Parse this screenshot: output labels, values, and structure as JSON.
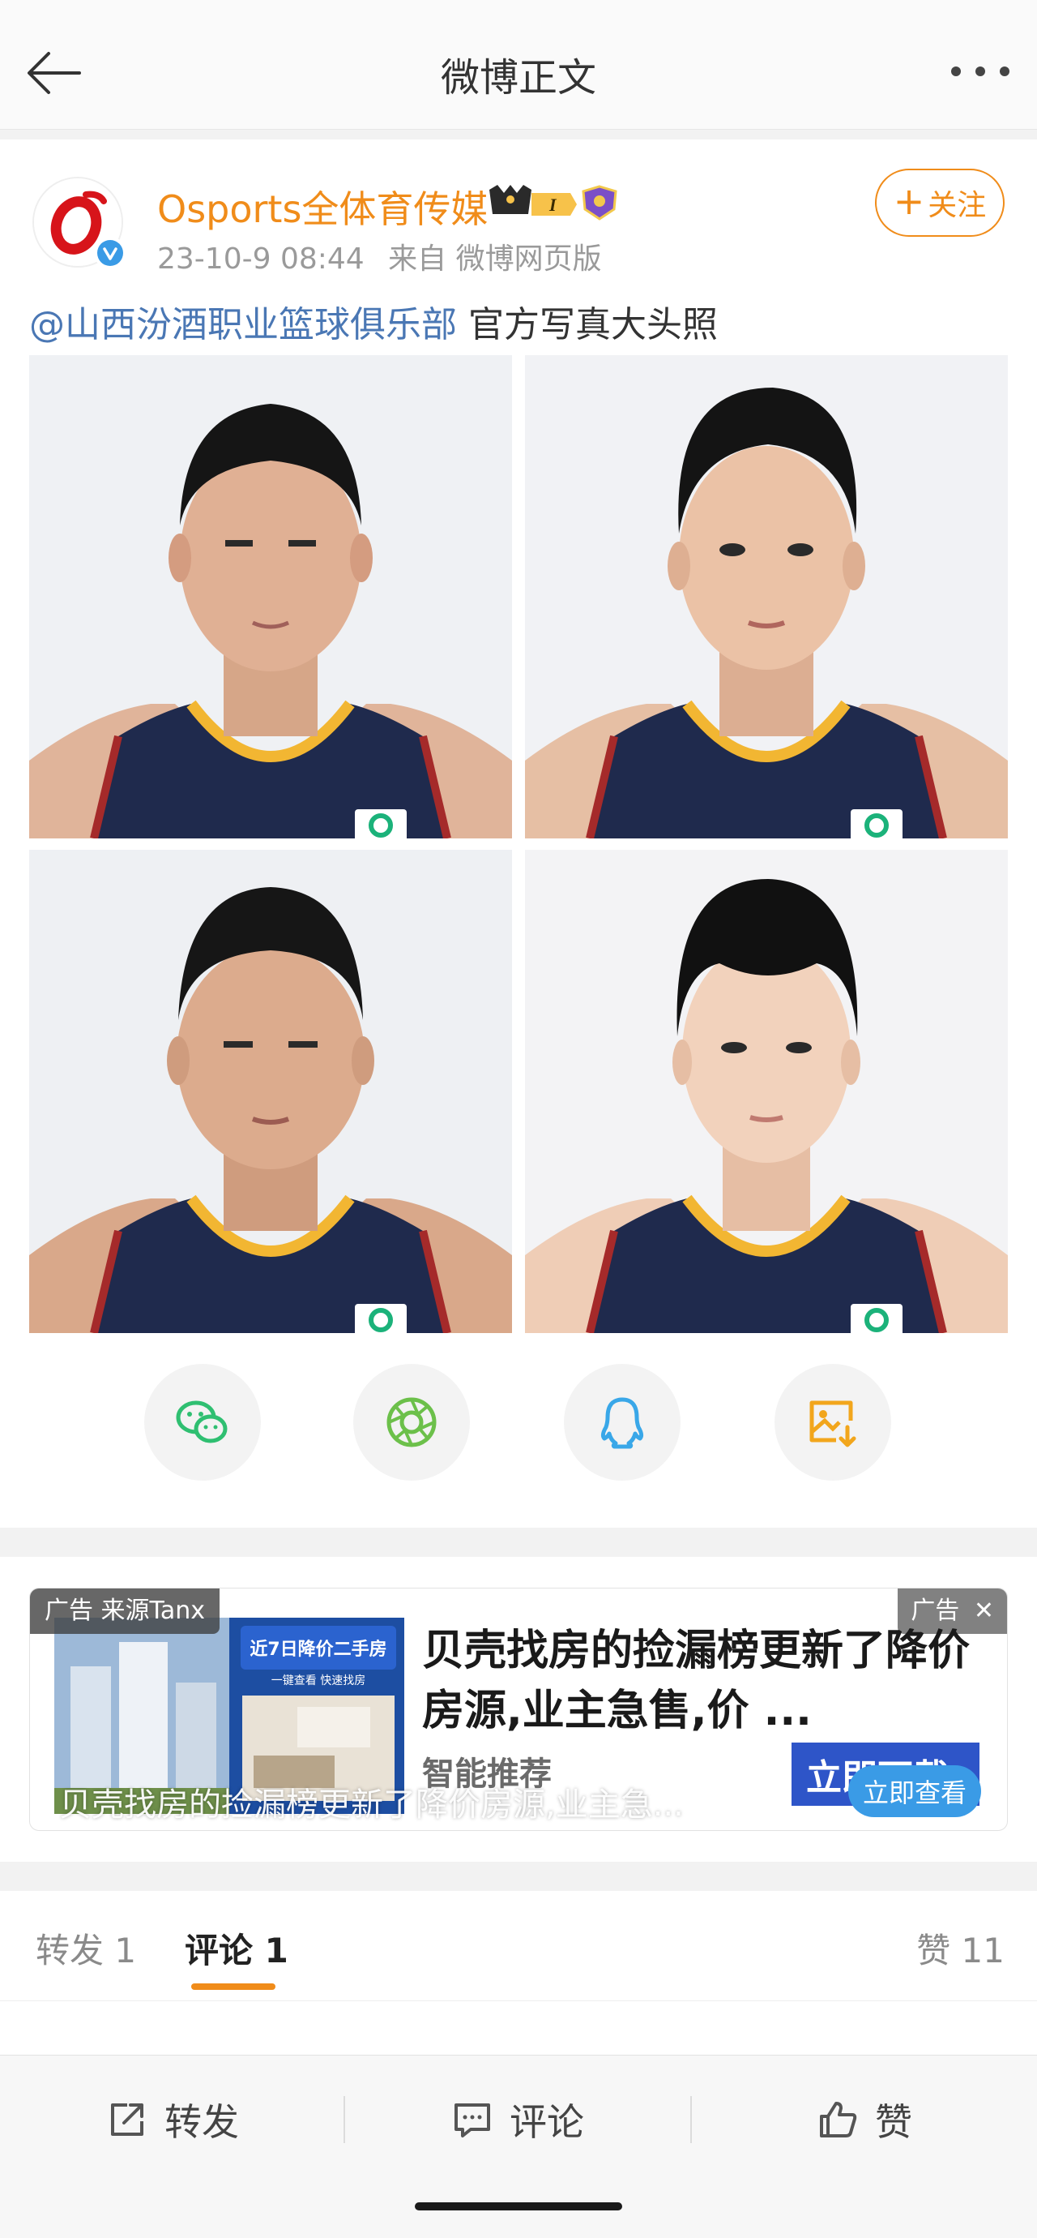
{
  "nav": {
    "title": "微博正文"
  },
  "post": {
    "username": "Osports全体育传媒",
    "vip_label": "I",
    "time": "23-10-9 08:44",
    "source": "来自 微博网页版",
    "follow_label": "关注",
    "mention": "@山西汾酒职业篮球俱乐部",
    "text": " 官方写真大头照",
    "photos": [
      "player-photo-1",
      "player-photo-2",
      "player-photo-3",
      "player-photo-4"
    ],
    "share_icons": [
      "wechat-icon",
      "moments-icon",
      "qq-icon",
      "save-image-icon"
    ]
  },
  "ad": {
    "tag_left": "广告 来源Tanx",
    "tag_right": "广告",
    "headline": "贝壳找房的捡漏榜更新了降价房源,业主急售,价 ...",
    "sub": "智能推荐",
    "download_label": "立即下载",
    "overlay_text": "贝壳找房的捡漏榜更新了降价房源,业主急...",
    "view_label": "立即查看",
    "image_banner": "近7日降价二手房",
    "image_subbanner": "一键查看 快速找房"
  },
  "tabs": {
    "repost": "转发 1",
    "comment": "评论 1",
    "like": "赞 11"
  },
  "toolbar": {
    "repost": "转发",
    "comment": "评论",
    "like": "赞"
  },
  "colors": {
    "accent": "#f08c1a",
    "link": "#4a77b4",
    "jersey": "#1f2a4d"
  }
}
